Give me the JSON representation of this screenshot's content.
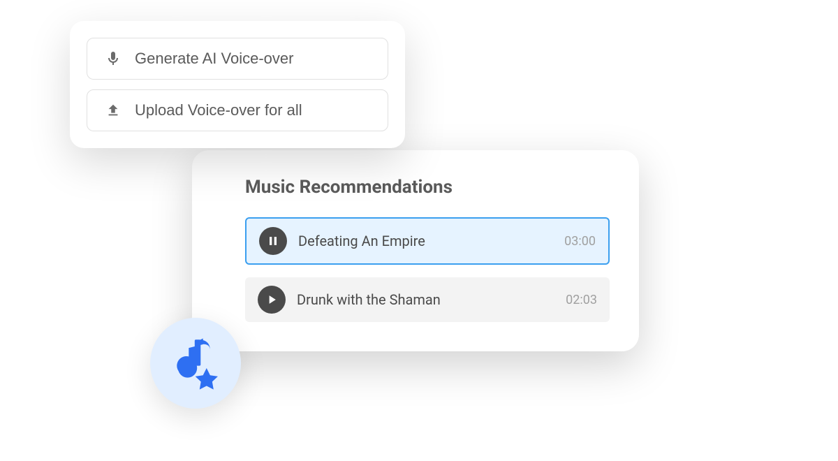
{
  "voice_panel": {
    "generate_label": "Generate AI Voice-over",
    "upload_label": "Upload Voice-over for all"
  },
  "music_panel": {
    "title": "Music Recommendations",
    "tracks": [
      {
        "name": "Defeating An Empire",
        "duration": "03:00",
        "state": "playing"
      },
      {
        "name": "Drunk with the Shaman",
        "duration": "02:03",
        "state": "paused"
      }
    ]
  },
  "colors": {
    "accent": "#3b9fef",
    "badge_bg": "#e1eeff",
    "badge_icon": "#2e6ff2"
  }
}
